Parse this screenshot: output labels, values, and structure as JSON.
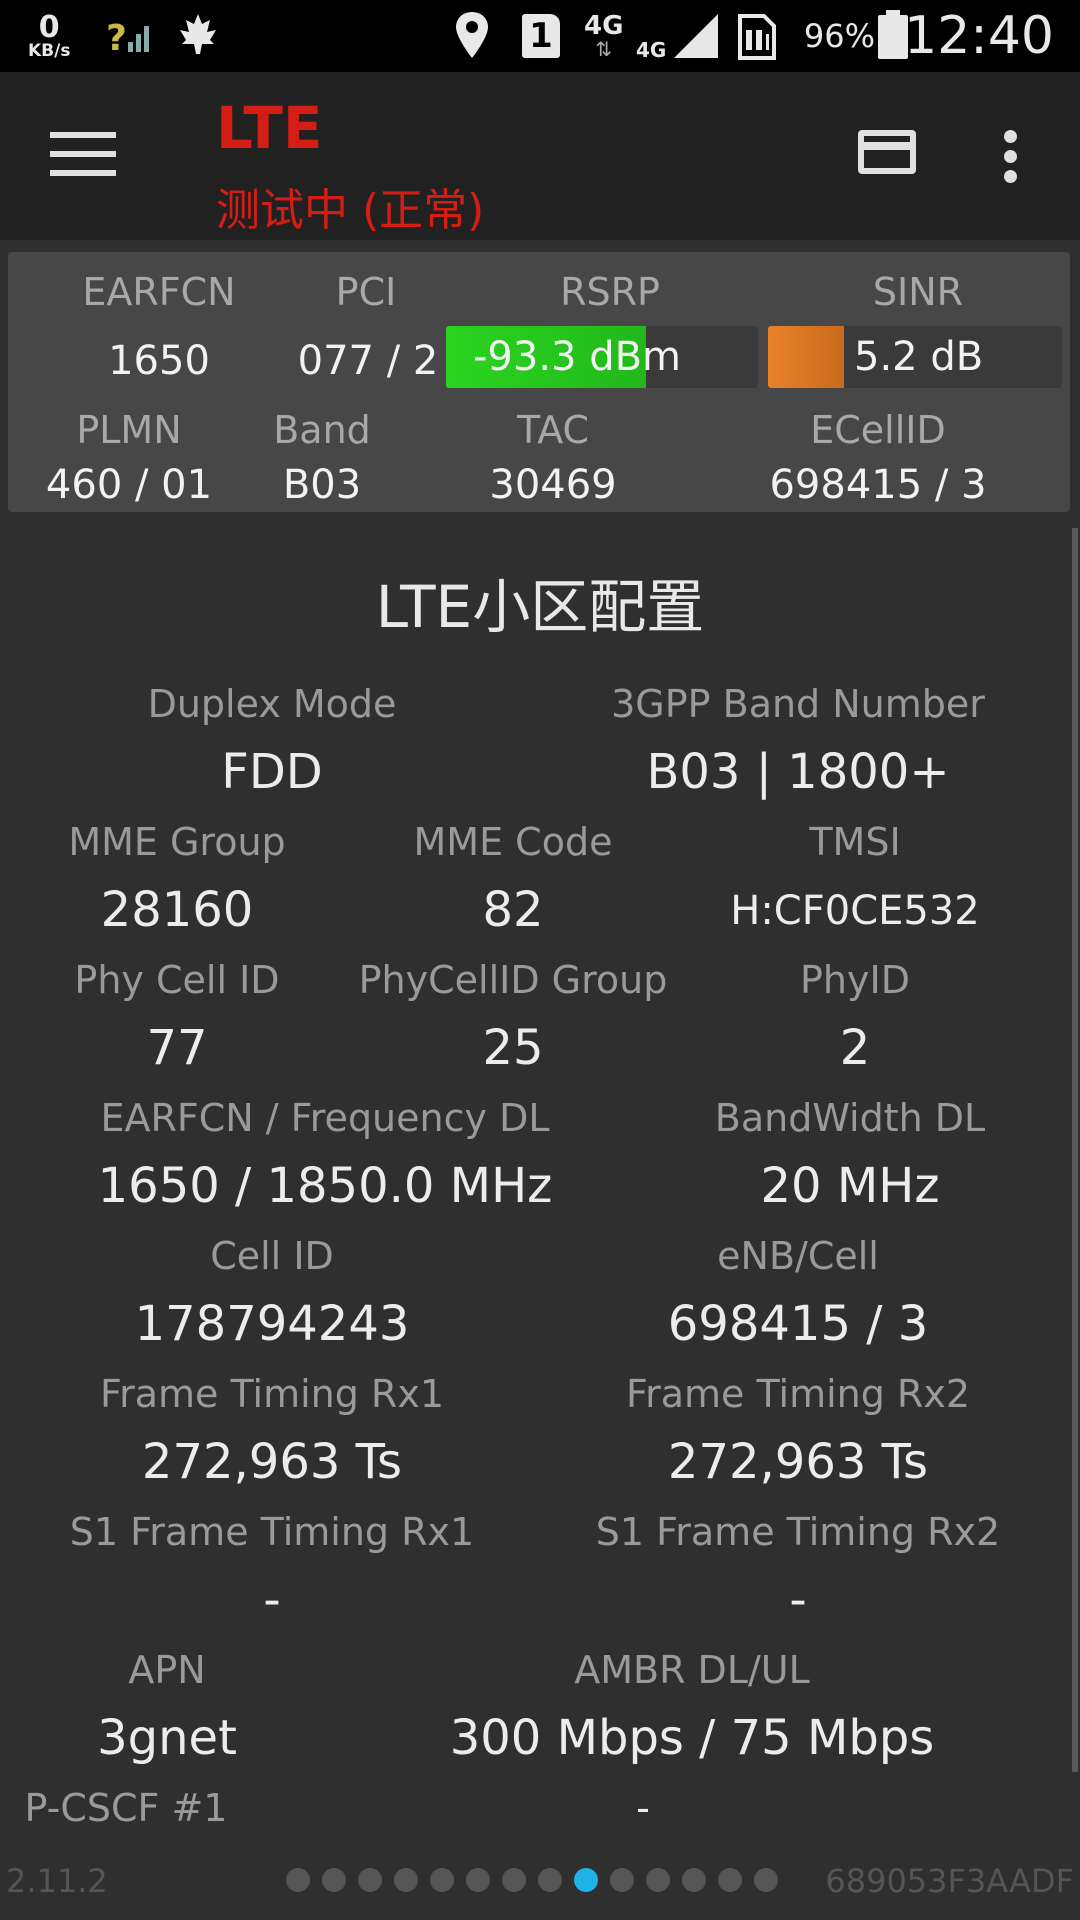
{
  "status_bar": {
    "net_speed_value": "0",
    "net_speed_unit": "KB/s",
    "sim_slot": "1",
    "network_type": "4G",
    "network_type_small": "4G",
    "battery_percent": "96%",
    "time": "12:40"
  },
  "app_bar": {
    "title": "LTE",
    "subtitle": "测试中 (正常)"
  },
  "summary": {
    "labels": {
      "earfcn": "EARFCN",
      "pci": "PCI",
      "rsrp": "RSRP",
      "sinr": "SINR",
      "plmn": "PLMN",
      "band": "Band",
      "tac": "TAC",
      "ecellid": "ECellID"
    },
    "values": {
      "earfcn": "1650",
      "pci": "077 / 2",
      "rsrp": "-93.3 dBm",
      "sinr": "5.2 dB",
      "plmn": "460 / 01",
      "band": "B03",
      "tac": "30469",
      "ecellid": "698415 / 3"
    },
    "rsrp_meter_level": 0.64,
    "sinr_meter_level": 0.26,
    "colors": {
      "rsrp_fill": "#2bd421",
      "sinr_fill": "#e8822a"
    }
  },
  "section": {
    "title": "LTE小区配置",
    "rows": [
      [
        {
          "label": "Duplex Mode",
          "value": "FDD"
        },
        {
          "label": "3GPP Band Number",
          "value": "B03 | 1800+"
        }
      ],
      [
        {
          "label": "MME Group",
          "value": "28160"
        },
        {
          "label": "MME Code",
          "value": "82"
        },
        {
          "label": "TMSI",
          "value": "H:CF0CE532"
        }
      ],
      [
        {
          "label": "Phy Cell ID",
          "value": "77"
        },
        {
          "label": "PhyCellID Group",
          "value": "25"
        },
        {
          "label": "PhyID",
          "value": "2"
        }
      ],
      [
        {
          "label": "EARFCN / Frequency DL",
          "value": "1650 / 1850.0 MHz"
        },
        {
          "label": "BandWidth DL",
          "value": "20 MHz"
        }
      ],
      [
        {
          "label": "Cell ID",
          "value": "178794243"
        },
        {
          "label": "eNB/Cell",
          "value": "698415 / 3"
        }
      ],
      [
        {
          "label": "Frame Timing Rx1",
          "value": "272,963 Ts"
        },
        {
          "label": "Frame Timing Rx2",
          "value": "272,963 Ts"
        }
      ],
      [
        {
          "label": "S1 Frame Timing Rx1",
          "value": "-"
        },
        {
          "label": "S1 Frame Timing Rx2",
          "value": "-"
        }
      ],
      [
        {
          "label": "APN",
          "value": "3gnet"
        },
        {
          "label": "AMBR DL/UL",
          "value": "300 Mbps / 75 Mbps"
        }
      ]
    ],
    "pcscf": {
      "label": "P-CSCF #1",
      "value": "-"
    }
  },
  "footer": {
    "version": "2.11.2",
    "device_id": "689053F3AADF",
    "page_count": 14,
    "active_page": 9
  }
}
